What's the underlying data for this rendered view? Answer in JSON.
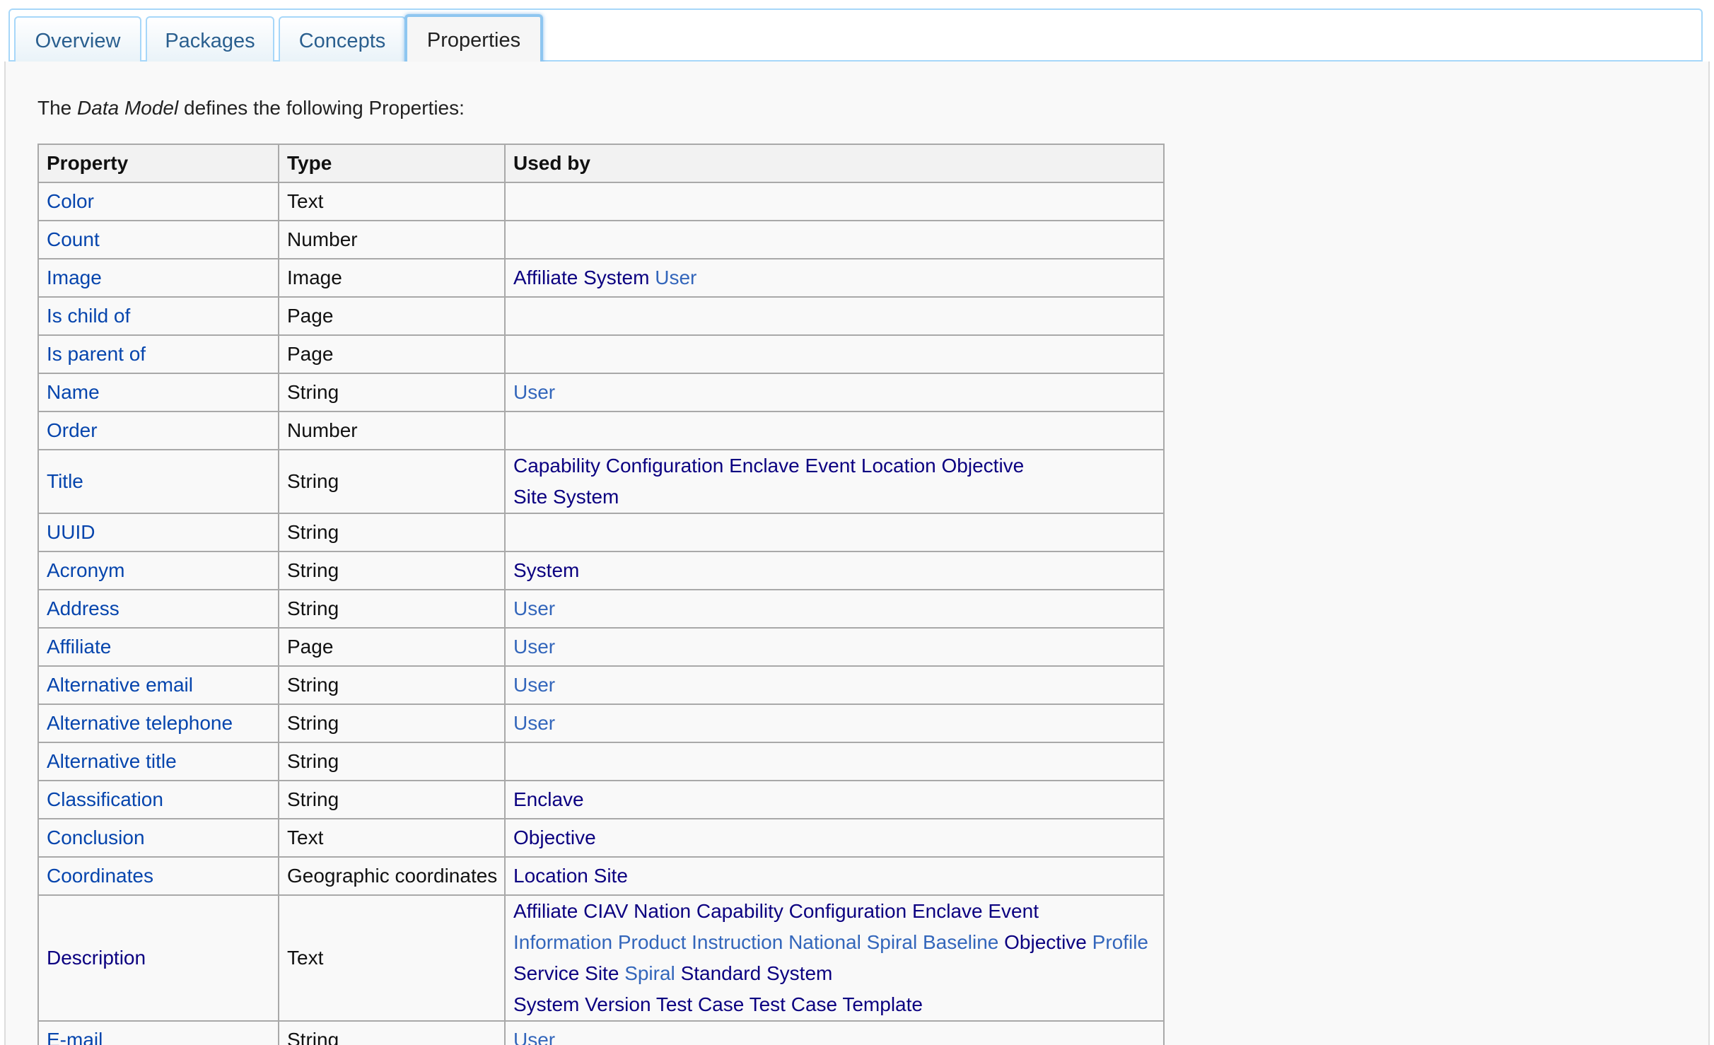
{
  "tabs": [
    {
      "label": "Overview"
    },
    {
      "label": "Packages"
    },
    {
      "label": "Concepts"
    },
    {
      "label": "Properties"
    }
  ],
  "intro": {
    "prefix": "The ",
    "model": "Data Model",
    "suffix": " defines the following Properties:"
  },
  "table": {
    "headers": [
      "Property",
      "Type",
      "Used by"
    ],
    "rows": [
      {
        "property": "Color",
        "type": "Text",
        "used_by": []
      },
      {
        "property": "Count",
        "type": "Number",
        "used_by": []
      },
      {
        "property": "Image",
        "type": "Image",
        "used_by": [
          [
            "Affiliate System",
            "User"
          ]
        ]
      },
      {
        "property": "Is child of",
        "type": "Page",
        "used_by": []
      },
      {
        "property": "Is parent of",
        "type": "Page",
        "used_by": []
      },
      {
        "property": "Name",
        "type": "String",
        "used_by": [
          [
            "User"
          ]
        ]
      },
      {
        "property": "Order",
        "type": "Number",
        "used_by": []
      },
      {
        "property": "Title",
        "type": "String",
        "used_by": [
          [
            "Capability",
            "Configuration",
            "Enclave",
            "Event",
            "Location",
            "Objective"
          ],
          [
            "Site",
            "System"
          ]
        ]
      },
      {
        "property": "UUID",
        "type": "String",
        "used_by": []
      },
      {
        "property": "Acronym",
        "type": "String",
        "used_by": [
          [
            "System"
          ]
        ]
      },
      {
        "property": "Address",
        "type": "String",
        "used_by": [
          [
            "User"
          ]
        ]
      },
      {
        "property": "Affiliate",
        "type": "Page",
        "used_by": [
          [
            "User"
          ]
        ]
      },
      {
        "property": "Alternative email",
        "type": "String",
        "used_by": [
          [
            "User"
          ]
        ]
      },
      {
        "property": "Alternative telephone",
        "type": "String",
        "used_by": [
          [
            "User"
          ]
        ]
      },
      {
        "property": "Alternative title",
        "type": "String",
        "used_by": []
      },
      {
        "property": "Classification",
        "type": "String",
        "used_by": [
          [
            "Enclave"
          ]
        ]
      },
      {
        "property": "Conclusion",
        "type": "Text",
        "used_by": [
          [
            "Objective"
          ]
        ]
      },
      {
        "property": "Coordinates",
        "type": "Geographic coordinates",
        "used_by": [
          [
            "Location",
            "Site"
          ]
        ]
      },
      {
        "property": "Description",
        "type": "Text",
        "used_by": [
          [
            "Affiliate",
            "CIAV Nation",
            "Capability",
            "Configuration",
            "Enclave",
            "Event"
          ],
          [
            "Information Product",
            "Instruction",
            "National Spiral Baseline",
            "Objective",
            "Profile"
          ],
          [
            "Service",
            "Site",
            "Spiral",
            "Standard",
            "System"
          ],
          [
            "System Version",
            "Test Case",
            "Test Case Template"
          ]
        ]
      },
      {
        "property": "E-mail",
        "type": "String",
        "used_by": [
          [
            "User"
          ]
        ]
      }
    ]
  },
  "new_links": [
    "User",
    "Information Product",
    "Instruction",
    "National Spiral Baseline",
    "Profile",
    "Spiral"
  ],
  "colors": {
    "link": "#0645ad",
    "visited_link": "#0b0080",
    "tab_border": "#a7d7f9",
    "tab_text": "#2a5f8f"
  }
}
